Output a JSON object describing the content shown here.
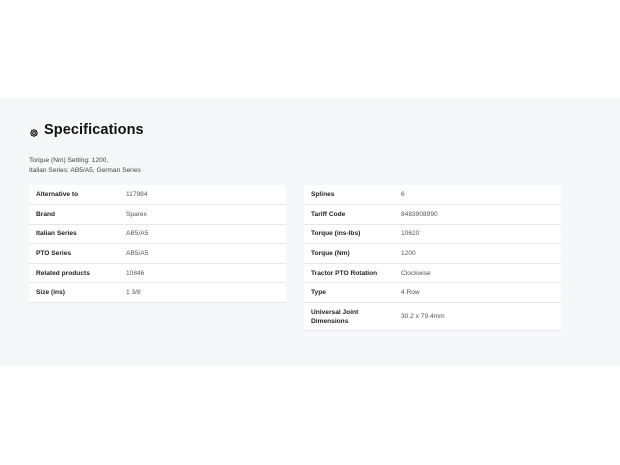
{
  "specifications": {
    "heading": "Specifications",
    "heading_icon": "gear-icon",
    "intro_lines": [
      "Torque (Nm) Setting: 1200,",
      "Italian Series: AB5/A5, German Series"
    ],
    "left_table": [
      {
        "label": "Alternative to",
        "value": "117984"
      },
      {
        "label": "Brand",
        "value": "Sparex"
      },
      {
        "label": "Italian Series",
        "value": "AB5/A5"
      },
      {
        "label": "PTO Series",
        "value": "AB5/A5"
      },
      {
        "label": "Related products",
        "value": "10846"
      },
      {
        "label": "Size (ins)",
        "value": "1 3/8"
      }
    ],
    "right_table": [
      {
        "label": "Splines",
        "value": "6"
      },
      {
        "label": "Tariff Code",
        "value": "8483908990"
      },
      {
        "label": "Torque (ins-lbs)",
        "value": "10620"
      },
      {
        "label": "Torque (Nm)",
        "value": "1200"
      },
      {
        "label": "Tractor PTO Rotation",
        "value": "Clockwise"
      },
      {
        "label": "Type",
        "value": "4 Row"
      },
      {
        "label": "Universal Joint Dimensions",
        "value": "30.2 x 79.4mm"
      }
    ]
  },
  "colors": {
    "section_background": "#f6f7f8",
    "row_border": "#e4e6e9",
    "heading_text": "#111111"
  }
}
